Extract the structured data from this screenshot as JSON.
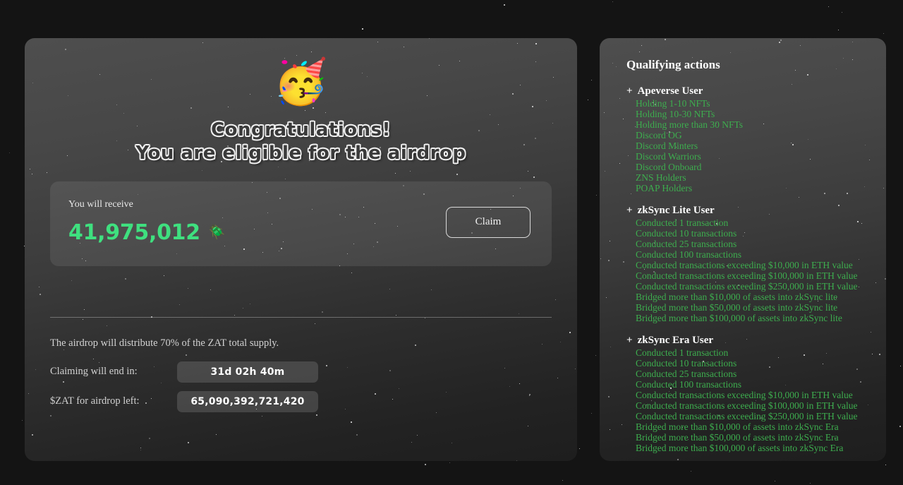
{
  "left_panel": {
    "emoji": "🥳",
    "emoji_name": "partying-face-emoji",
    "headline_line1": "Congratulations!",
    "headline_line2": "You are eligible for the airdrop",
    "receive": {
      "label": "You will receive",
      "amount": "41,975,012",
      "token_emoji": "🪲",
      "claim_label": "Claim"
    },
    "info": {
      "note": "The airdrop will distribute 70% of the ZAT total supply.",
      "rows": [
        {
          "key": "Claiming will end in:",
          "value": "31d 02h 40m"
        },
        {
          "key": "$ZAT for airdrop left:",
          "value": "65,090,392,721,420"
        }
      ]
    }
  },
  "right_panel": {
    "title": "Qualifying actions",
    "plus": "+",
    "groups": [
      {
        "name": "Apeverse User",
        "items": [
          "Holding 1-10 NFTs",
          "Holding 10-30 NFTs",
          "Holding more than 30 NFTs",
          "Discord OG",
          "Discord Minters",
          "Discord Warriors",
          "Discord Onboard",
          "ZNS Holders",
          "POAP Holders"
        ]
      },
      {
        "name": "zkSync Lite User",
        "items": [
          "Conducted 1 transaction",
          "Conducted 10 transactions",
          "Conducted 25 transactions",
          "Conducted 100 transactions",
          "Conducted transactions exceeding $10,000 in ETH value",
          "Conducted transactions exceeding $100,000 in ETH value",
          "Conducted transactions exceeding $250,000 in ETH value",
          "Bridged more than $10,000 of assets into zkSync lite",
          "Bridged more than $50,000 of assets into zkSync lite",
          "Bridged more than $100,000 of assets into zkSync lite"
        ]
      },
      {
        "name": "zkSync Era User",
        "items": [
          "Conducted 1 transaction",
          "Conducted 10 transactions",
          "Conducted 25 transactions",
          "Conducted 100 transactions",
          "Conducted transactions exceeding $10,000 in ETH value",
          "Conducted transactions exceeding $100,000 in ETH value",
          "Conducted transactions exceeding $250,000 in ETH value",
          "Bridged more than $10,000 of assets into zkSync Era",
          "Bridged more than $50,000 of assets into zkSync Era",
          "Bridged more than $100,000 of assets into zkSync Era"
        ]
      }
    ]
  },
  "colors": {
    "page_background": "#141414",
    "card_top": "#4e4e4e",
    "card_bottom": "#1e1e1e",
    "amount_green": "#3fe07f",
    "list_green": "#3dad4e",
    "text_light": "#e9e9e9"
  }
}
